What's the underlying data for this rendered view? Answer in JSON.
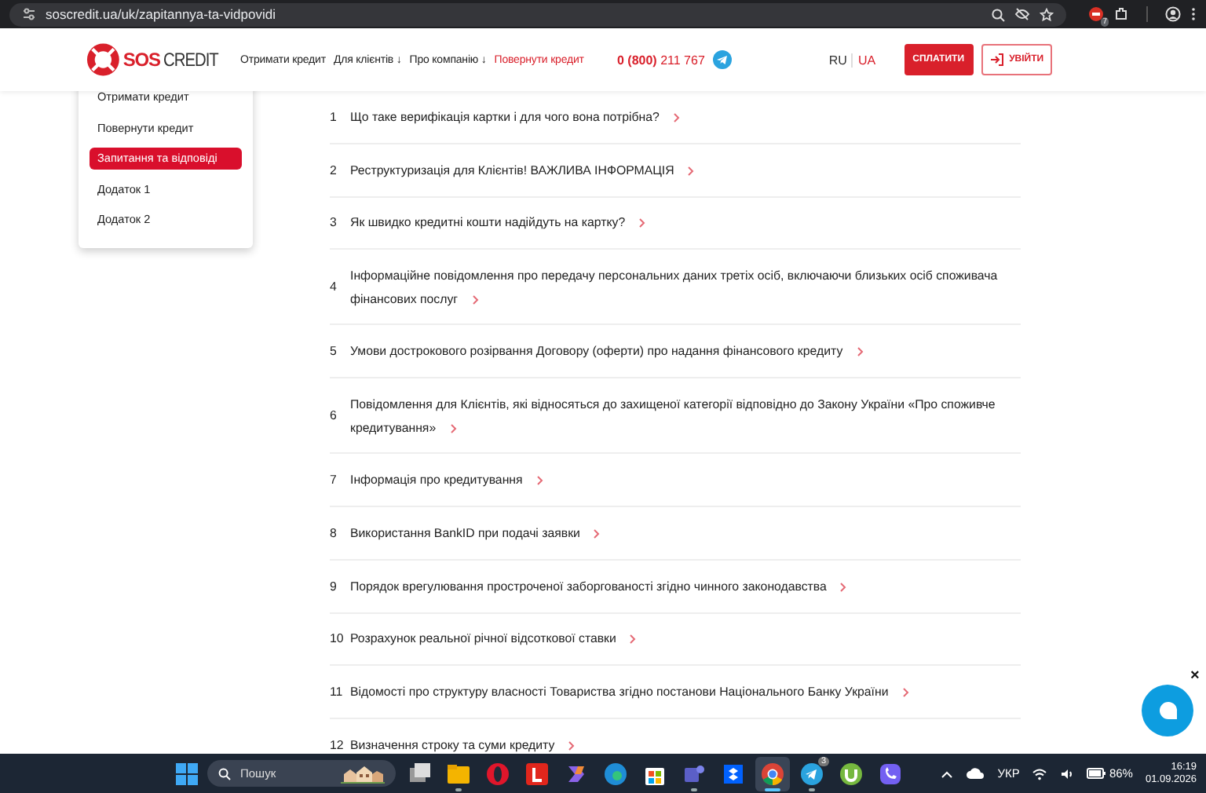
{
  "browser": {
    "url": "soscredit.ua/uk/zapitannya-ta-vidpovidi",
    "extension_badge": "7"
  },
  "header": {
    "logo": {
      "part_1": "SOS",
      "part_2": "CREDIT"
    },
    "nav": [
      {
        "label": "Отримати кредит",
        "kind": "link"
      },
      {
        "label": "Для клієнтів ↓",
        "kind": "link"
      },
      {
        "label": "Про компанію ↓",
        "kind": "link"
      },
      {
        "label": "Повернути кредит",
        "kind": "accent"
      }
    ],
    "phone": {
      "prefix": "0 (800)",
      "number": "211 767"
    },
    "languages": [
      {
        "label": "RU",
        "selected": false
      },
      {
        "label": "UA",
        "selected": true
      }
    ],
    "pay_button": "СПЛАТИТИ",
    "login_button": "УВІЙТИ"
  },
  "side_menu": {
    "items": [
      {
        "label": "Отримати кредит",
        "selected": false
      },
      {
        "label": "Повернути кредит",
        "selected": false
      },
      {
        "label": "Запитання та відповіді",
        "selected": true
      },
      {
        "label": "Додаток 1",
        "selected": false
      },
      {
        "label": "Додаток 2",
        "selected": false
      }
    ]
  },
  "faq": [
    {
      "number": "1",
      "question": "Що таке верифікація картки і для чого вона потрібна?"
    },
    {
      "number": "2",
      "question": "Реструктуризація для Клієнтів! ВАЖЛИВА ІНФОРМАЦІЯ"
    },
    {
      "number": "3",
      "question": "Як швидко кредитні кошти надійдуть на картку?"
    },
    {
      "number": "4",
      "question": "Інформаційне повідомлення про передачу персональних даних третіх осіб, включаючи близьких осіб споживача фінансових послуг"
    },
    {
      "number": "5",
      "question": "Умови дострокового розірвання Договору (оферти) про надання фінансового кредиту"
    },
    {
      "number": "6",
      "question": "Повідомлення для Клієнтів, які відносяться до захищеної категорії відповідно до Закону України «Про споживче кредитування»"
    },
    {
      "number": "7",
      "question": "Інформація про кредитування"
    },
    {
      "number": "8",
      "question": "Використання BankID при подачі заявки"
    },
    {
      "number": "9",
      "question": "Порядок врегулювання простроченої заборгованості згідно чинного законодавства"
    },
    {
      "number": "10",
      "question": "Розрахунок реальної річної відсоткової ставки"
    },
    {
      "number": "11",
      "question": "Відомості про структуру власності Товариства згідно постанови Національного Банку України"
    },
    {
      "number": "12",
      "question": "Визначення строку та суми кредиту"
    }
  ],
  "chat": {
    "close": "×"
  },
  "taskbar": {
    "search_placeholder": "Пошук",
    "apps": [
      {
        "kind": "taskview",
        "running": false,
        "selected": false
      },
      {
        "kind": "explorer",
        "running": true,
        "selected": false
      },
      {
        "kind": "opera",
        "running": false,
        "selected": false
      },
      {
        "kind": "lapp",
        "running": false,
        "selected": false
      },
      {
        "kind": "copilot",
        "running": false,
        "selected": false
      },
      {
        "kind": "edge",
        "running": false,
        "selected": false
      },
      {
        "kind": "store",
        "running": false,
        "selected": false
      },
      {
        "kind": "teams",
        "running": true,
        "selected": false
      },
      {
        "kind": "dropbox",
        "running": false,
        "selected": false
      },
      {
        "kind": "chrome",
        "running": true,
        "selected": true
      },
      {
        "kind": "telegram",
        "running": true,
        "selected": false,
        "badge": "3"
      },
      {
        "kind": "utorrent",
        "running": false,
        "selected": false
      },
      {
        "kind": "viber",
        "running": false,
        "selected": false
      }
    ],
    "language": "УКР",
    "battery": "86%",
    "time": "16:19",
    "date": "01.09.2026"
  }
}
